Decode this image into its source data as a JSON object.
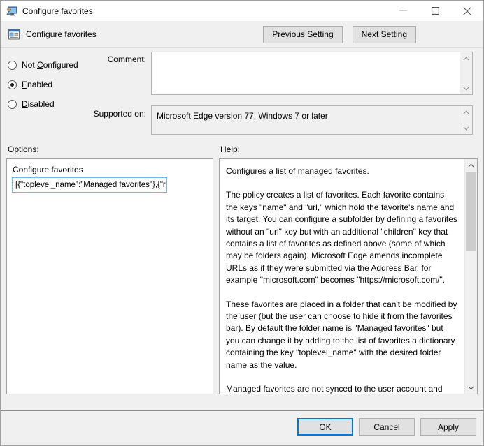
{
  "window": {
    "title": "Configure favorites",
    "icon": "policy-setting-icon",
    "controls": {
      "minimize": "minimize-icon",
      "maximize": "maximize-icon",
      "close": "close-icon"
    }
  },
  "header": {
    "icon": "setting-icon",
    "title": "Configure favorites",
    "previous_setting": "Previous Setting",
    "previous_setting_accel": "P",
    "next_setting": "Next Setting"
  },
  "state": {
    "options": [
      {
        "label": "Not Configured",
        "accel": "C",
        "selected": false
      },
      {
        "label": "Enabled",
        "accel": "E",
        "selected": true
      },
      {
        "label": "Disabled",
        "accel": "D",
        "selected": false
      }
    ]
  },
  "comment": {
    "label": "Comment:",
    "value": ""
  },
  "supported_on": {
    "label": "Supported on:",
    "value": "Microsoft Edge version 77, Windows 7 or later"
  },
  "options_panel": {
    "label": "Options:",
    "title": "Configure favorites",
    "input_value": "[{\"toplevel_name\":\"Managed favorites\"},{\"r",
    "input_placeholder": ""
  },
  "help_panel": {
    "label": "Help:",
    "paragraphs": [
      "Configures a list of managed favorites.",
      "The policy creates a list of favorites. Each favorite contains the keys \"name\" and \"url,\" which hold the favorite's name and its target. You can configure a subfolder by defining a favorites without an \"url\" key but with an additional \"children\" key that contains a list of favorites as defined above (some of which may be folders again). Microsoft Edge amends incomplete URLs as if they were submitted via the Address Bar, for example \"microsoft.com\" becomes \"https://microsoft.com/\".",
      "These favorites are placed in a folder that can't be modified by the user (but the user can choose to hide it from the favorites bar). By default the folder name is \"Managed favorites\" but you can change it by adding to the list of favorites a dictionary containing the key \"toplevel_name\" with the desired folder name as the value.",
      "Managed favorites are not synced to the user account and can't be modified by extensions."
    ]
  },
  "footer": {
    "ok": "OK",
    "cancel": "Cancel",
    "apply": "Apply",
    "apply_accel": "A"
  },
  "colors": {
    "focus_blue": "#0078d7",
    "input_focus_border": "#7eb4ea",
    "dialog_bg": "#f0f0f0",
    "panel_bg": "#ffffff"
  }
}
